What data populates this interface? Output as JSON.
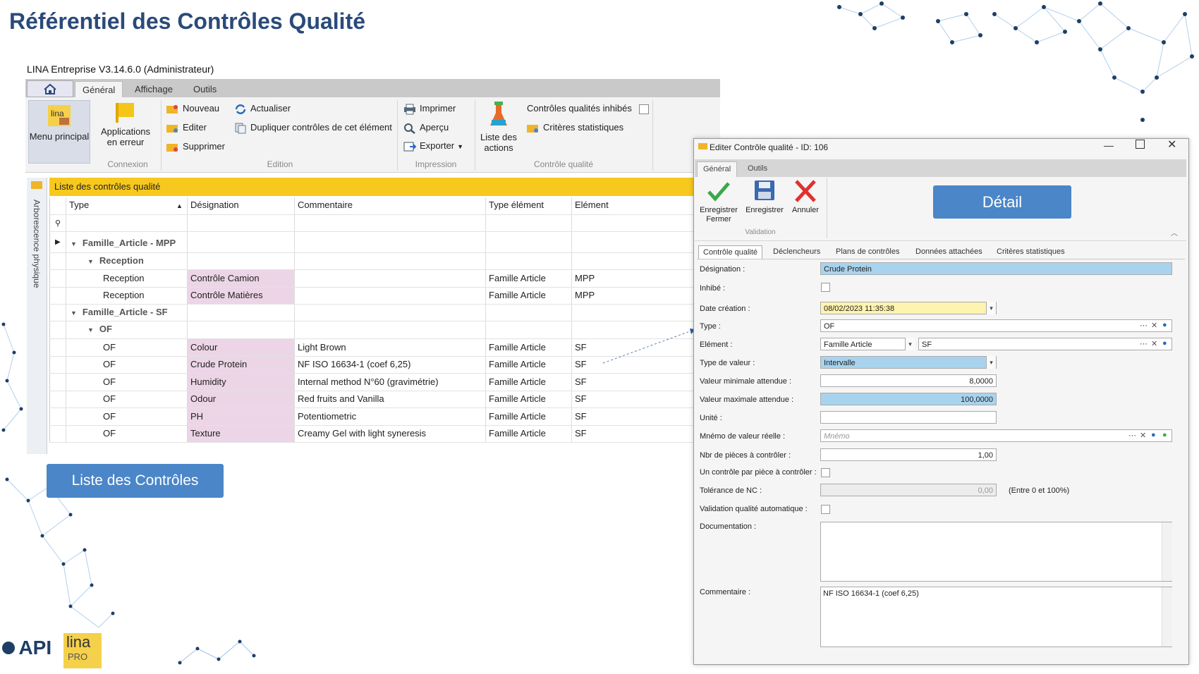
{
  "slide": {
    "title": "Référentiel des Contrôles Qualité",
    "list_button": "Liste des Contrôles",
    "detail_button": "Détail",
    "logo_api": "API",
    "logo_lina": "lina",
    "logo_pro": "PRO"
  },
  "app": {
    "title": "LINA Entreprise  V3.14.6.0  (Administrateur)",
    "tabs": [
      "Général",
      "Affichage",
      "Outils"
    ],
    "ribbon": {
      "menu_principal": "Menu principal",
      "applications_line1": "Applications",
      "applications_line2": "en erreur",
      "nouveau": "Nouveau",
      "editer": "Editer",
      "supprimer": "Supprimer",
      "actualiser": "Actualiser",
      "dupliquer": "Dupliquer contrôles de cet élément",
      "imprimer": "Imprimer",
      "apercu": "Aperçu",
      "exporter": "Exporter",
      "liste_actions_line1": "Liste des",
      "liste_actions_line2": "actions",
      "controles_inhibes": "Contrôles qualités inhibés",
      "criteres_statistiques": "Critères statistiques",
      "groups": {
        "connexion": "Connexion",
        "edition": "Edition",
        "impression": "Impression",
        "controle_qualite": "Contrôle qualité"
      }
    },
    "side_panel": "Arborescence physique",
    "grid": {
      "header": "Liste des contrôles qualité",
      "columns": [
        "Type",
        "Désignation",
        "Commentaire",
        "Type élément",
        "Elément"
      ],
      "groups": {
        "mpp": "Famille_Article - MPP",
        "reception": "Reception",
        "sf": "Famille_Article - SF",
        "of": "OF"
      },
      "rows_mpp": [
        {
          "type": "Reception",
          "designation": "Contrôle Camion",
          "commentaire": "",
          "type_element": "Famille Article",
          "element": "MPP"
        },
        {
          "type": "Reception",
          "designation": "Contrôle Matières",
          "commentaire": "",
          "type_element": "Famille Article",
          "element": "MPP"
        }
      ],
      "rows_sf": [
        {
          "type": "OF",
          "designation": "Colour",
          "commentaire": "Light Brown",
          "type_element": "Famille Article",
          "element": "SF"
        },
        {
          "type": "OF",
          "designation": "Crude Protein",
          "commentaire": "NF ISO 16634-1 (coef 6,25)",
          "type_element": "Famille Article",
          "element": "SF"
        },
        {
          "type": "OF",
          "designation": "Humidity",
          "commentaire": "Internal method N°60 (gravimétrie)",
          "type_element": "Famille Article",
          "element": "SF"
        },
        {
          "type": "OF",
          "designation": "Odour",
          "commentaire": "Red fruits and Vanilla",
          "type_element": "Famille Article",
          "element": "SF"
        },
        {
          "type": "OF",
          "designation": "PH",
          "commentaire": "Potentiometric",
          "type_element": "Famille Article",
          "element": "SF"
        },
        {
          "type": "OF",
          "designation": "Texture",
          "commentaire": "Creamy Gel with light syneresis",
          "type_element": "Famille Article",
          "element": "SF"
        }
      ]
    }
  },
  "dialog": {
    "title": "Editer Contrôle qualité - ID: 106",
    "tabs": [
      "Général",
      "Outils"
    ],
    "ribbon": {
      "enregistrer_fermer_line1": "Enregistrer",
      "enregistrer_fermer_line2": "Fermer",
      "enregistrer": "Enregistrer",
      "annuler": "Annuler",
      "group": "Validation"
    },
    "subtabs": [
      "Contrôle qualité",
      "Déclencheurs",
      "Plans de contrôles",
      "Données attachées",
      "Critères statistiques"
    ],
    "labels": {
      "designation": "Désignation :",
      "inhibe": "Inhibé :",
      "date_creation": "Date création :",
      "type": "Type :",
      "element": "Elément :",
      "type_valeur": "Type de valeur :",
      "valeur_min": "Valeur minimale attendue :",
      "valeur_max": "Valeur maximale attendue :",
      "unite": "Unité :",
      "memo": "Mnémo de valeur réelle :",
      "nbr_pieces": "Nbr de pièces à contrôler :",
      "un_controle": "Un contrôle par pièce à contrôler :",
      "tolerance": "Tolérance de NC :",
      "validation_auto": "Validation qualité automatique :",
      "documentation": "Documentation :",
      "commentaire": "Commentaire :"
    },
    "values": {
      "designation": "Crude Protein",
      "date_creation": "08/02/2023 11:35:38",
      "type": "OF",
      "element_type": "Famille Article",
      "element": "SF",
      "type_valeur": "Intervalle",
      "valeur_min": "8,0000",
      "valeur_max": "100,0000",
      "unite": "",
      "memo_placeholder": "Mnémo",
      "nbr_pieces": "1,00",
      "tolerance": "0,00",
      "tolerance_hint": "(Entre 0 et 100%)",
      "documentation": "",
      "commentaire": "NF ISO 16634-1 (coef 6,25)"
    }
  }
}
